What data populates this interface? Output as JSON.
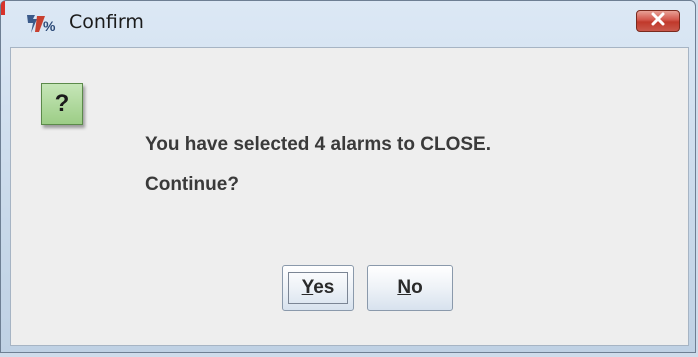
{
  "window": {
    "title": "Confirm",
    "close_icon": "close-x-icon",
    "app_icon": "java-app-icon"
  },
  "dialog": {
    "icon": "question-icon",
    "icon_glyph": "?",
    "message_line1": "You have selected 4 alarms to CLOSE.",
    "message_line2": "Continue?"
  },
  "buttons": {
    "yes": {
      "mnemonic": "Y",
      "rest": "es"
    },
    "no": {
      "mnemonic": "N",
      "rest": "o"
    }
  },
  "colors": {
    "question_icon_bg": "#9ccd86",
    "close_button": "#c0392b"
  }
}
